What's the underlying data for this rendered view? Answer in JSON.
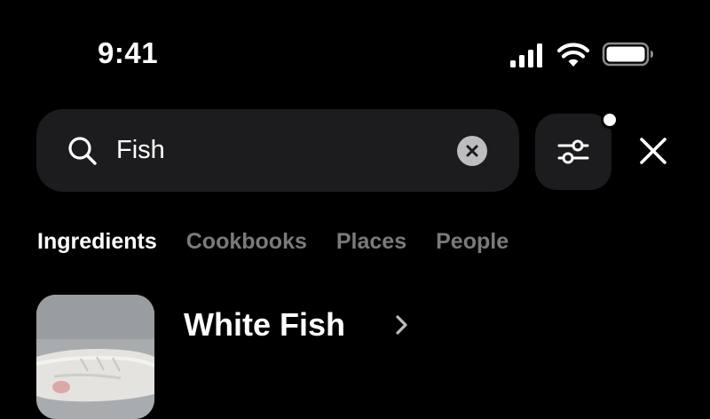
{
  "status_bar": {
    "time": "9:41",
    "icons": [
      "cellular-signal-icon",
      "wifi-icon",
      "battery-icon"
    ]
  },
  "search": {
    "value": "Fish",
    "placeholder": "",
    "icon": "search-icon",
    "clear_icon": "clear-icon"
  },
  "filter": {
    "icon": "sliders-icon",
    "has_active_indicator": true
  },
  "close": {
    "icon": "close-icon"
  },
  "tabs": [
    {
      "label": "Ingredients",
      "active": true
    },
    {
      "label": "Cookbooks",
      "active": false
    },
    {
      "label": "Places",
      "active": false
    },
    {
      "label": "People",
      "active": false
    }
  ],
  "results": [
    {
      "title": "White Fish",
      "icon": "chevron-right-icon"
    }
  ],
  "colors": {
    "background": "#000000",
    "surface": "#1c1c1e",
    "text_primary": "#ffffff",
    "text_inactive": "#7a7a7c",
    "clear_button": "#bdbdbf"
  }
}
